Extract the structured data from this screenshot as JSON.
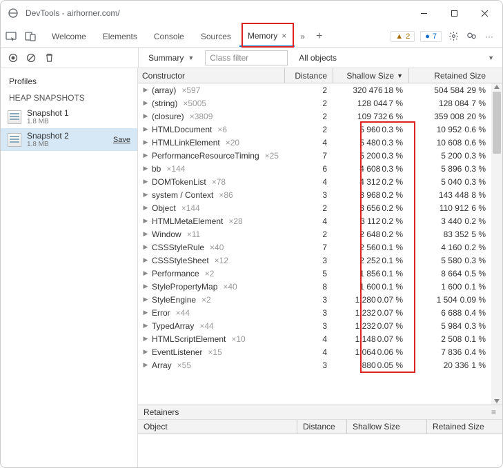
{
  "window": {
    "title": "DevTools - airhorner.com/"
  },
  "tabs": {
    "items": [
      "Welcome",
      "Elements",
      "Console",
      "Sources",
      "Memory"
    ],
    "active_index": 4
  },
  "badges": {
    "warn": "2",
    "info": "7"
  },
  "toolbar": {
    "summary_label": "Summary",
    "class_filter_placeholder": "Class filter",
    "scope_label": "All objects"
  },
  "sidebar": {
    "title": "Profiles",
    "subtitle": "HEAP SNAPSHOTS",
    "snapshots": [
      {
        "name": "Snapshot 1",
        "size": "1.8 MB",
        "selected": false,
        "save": false
      },
      {
        "name": "Snapshot 2",
        "size": "1.8 MB",
        "selected": true,
        "save": true
      }
    ],
    "save_label": "Save"
  },
  "table": {
    "headers": {
      "constructor_": "Constructor",
      "distance": "Distance",
      "shallow": "Shallow Size",
      "retained": "Retained Size"
    },
    "rows": [
      {
        "name": "(array)",
        "paren": true,
        "count": "×597",
        "dist": "2",
        "sh": "320 476",
        "shp": "18 %",
        "ret": "504 584",
        "retp": "29 %"
      },
      {
        "name": "(string)",
        "paren": true,
        "count": "×5005",
        "dist": "2",
        "sh": "128 044",
        "shp": "7 %",
        "ret": "128 084",
        "retp": "7 %"
      },
      {
        "name": "(closure)",
        "paren": true,
        "count": "×3809",
        "dist": "2",
        "sh": "109 732",
        "shp": "6 %",
        "ret": "359 008",
        "retp": "20 %"
      },
      {
        "name": "HTMLDocument",
        "count": "×6",
        "dist": "2",
        "sh": "5 960",
        "shp": "0.3 %",
        "ret": "10 952",
        "retp": "0.6 %"
      },
      {
        "name": "HTMLLinkElement",
        "count": "×20",
        "dist": "4",
        "sh": "5 480",
        "shp": "0.3 %",
        "ret": "10 608",
        "retp": "0.6 %"
      },
      {
        "name": "PerformanceResourceTiming",
        "count": "×25",
        "dist": "7",
        "sh": "5 200",
        "shp": "0.3 %",
        "ret": "5 200",
        "retp": "0.3 %"
      },
      {
        "name": "bb",
        "count": "×144",
        "dist": "6",
        "sh": "4 608",
        "shp": "0.3 %",
        "ret": "5 896",
        "retp": "0.3 %"
      },
      {
        "name": "DOMTokenList",
        "count": "×78",
        "dist": "4",
        "sh": "4 312",
        "shp": "0.2 %",
        "ret": "5 040",
        "retp": "0.3 %"
      },
      {
        "name": "system / Context",
        "count": "×86",
        "dist": "3",
        "sh": "3 968",
        "shp": "0.2 %",
        "ret": "143 448",
        "retp": "8 %"
      },
      {
        "name": "Object",
        "count": "×144",
        "dist": "2",
        "sh": "3 656",
        "shp": "0.2 %",
        "ret": "110 912",
        "retp": "6 %"
      },
      {
        "name": "HTMLMetaElement",
        "count": "×28",
        "dist": "4",
        "sh": "3 112",
        "shp": "0.2 %",
        "ret": "3 440",
        "retp": "0.2 %"
      },
      {
        "name": "Window",
        "count": "×11",
        "dist": "2",
        "sh": "2 648",
        "shp": "0.2 %",
        "ret": "83 352",
        "retp": "5 %"
      },
      {
        "name": "CSSStyleRule",
        "count": "×40",
        "dist": "7",
        "sh": "2 560",
        "shp": "0.1 %",
        "ret": "4 160",
        "retp": "0.2 %"
      },
      {
        "name": "CSSStyleSheet",
        "count": "×12",
        "dist": "3",
        "sh": "2 252",
        "shp": "0.1 %",
        "ret": "5 580",
        "retp": "0.3 %"
      },
      {
        "name": "Performance",
        "count": "×2",
        "dist": "5",
        "sh": "1 856",
        "shp": "0.1 %",
        "ret": "8 664",
        "retp": "0.5 %"
      },
      {
        "name": "StylePropertyMap",
        "count": "×40",
        "dist": "8",
        "sh": "1 600",
        "shp": "0.1 %",
        "ret": "1 600",
        "retp": "0.1 %"
      },
      {
        "name": "StyleEngine",
        "count": "×2",
        "dist": "3",
        "sh": "1 280",
        "shp": "0.07 %",
        "ret": "1 504",
        "retp": "0.09 %"
      },
      {
        "name": "Error",
        "count": "×44",
        "dist": "3",
        "sh": "1 232",
        "shp": "0.07 %",
        "ret": "6 688",
        "retp": "0.4 %"
      },
      {
        "name": "TypedArray",
        "count": "×44",
        "dist": "3",
        "sh": "1 232",
        "shp": "0.07 %",
        "ret": "5 984",
        "retp": "0.3 %"
      },
      {
        "name": "HTMLScriptElement",
        "count": "×10",
        "dist": "4",
        "sh": "1 148",
        "shp": "0.07 %",
        "ret": "2 508",
        "retp": "0.1 %"
      },
      {
        "name": "EventListener",
        "count": "×15",
        "dist": "4",
        "sh": "1 064",
        "shp": "0.06 %",
        "ret": "7 836",
        "retp": "0.4 %"
      },
      {
        "name": "Array",
        "count": "×55",
        "dist": "3",
        "sh": "880",
        "shp": "0.05 %",
        "ret": "20 336",
        "retp": "1 %"
      }
    ]
  },
  "retainers": {
    "title": "Retainers",
    "headers": {
      "object": "Object",
      "distance": "Distance",
      "shallow": "Shallow Size",
      "retained": "Retained Size"
    }
  }
}
